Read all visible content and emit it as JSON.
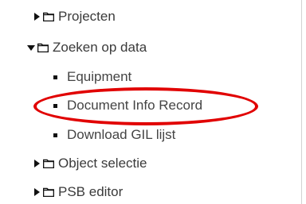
{
  "tree": {
    "items": [
      {
        "label": "Projecten",
        "expanded": false,
        "icon": "folder-icon"
      },
      {
        "label": "Zoeken op data",
        "expanded": true,
        "icon": "folder-icon",
        "children": [
          {
            "label": "Equipment"
          },
          {
            "label": "Document Info Record"
          },
          {
            "label": "Download GIL lijst"
          }
        ]
      },
      {
        "label": "Object selectie",
        "expanded": false,
        "icon": "folder-icon"
      },
      {
        "label": "PSB editor",
        "expanded": false,
        "icon": "folder-icon"
      }
    ]
  },
  "highlight": {
    "color": "#e10000",
    "target": "Document Info Record"
  }
}
